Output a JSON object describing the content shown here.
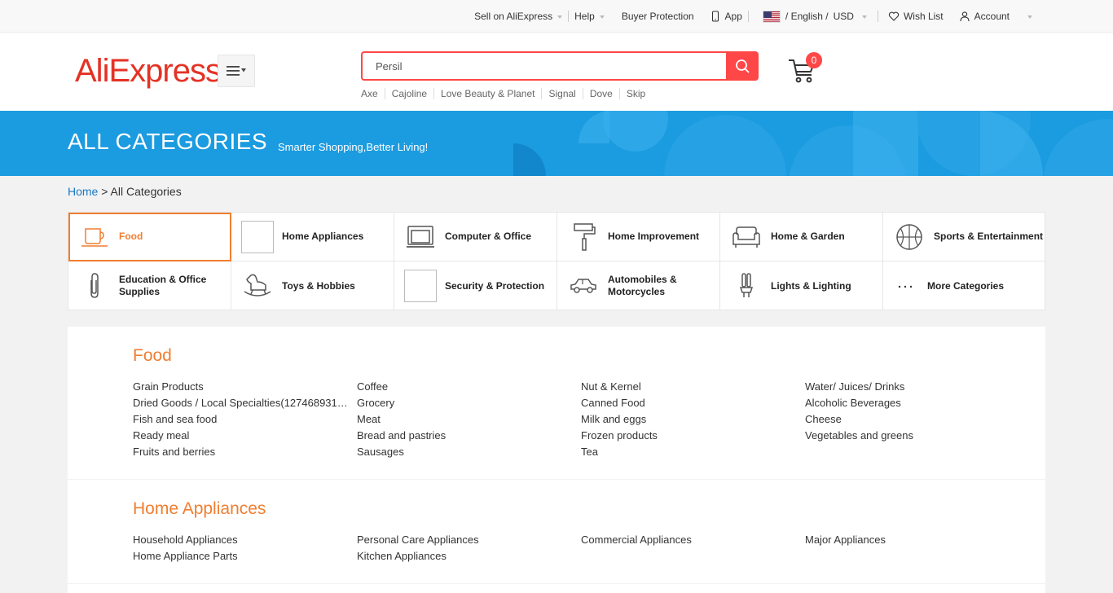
{
  "topbar": {
    "sell": "Sell on AliExpress",
    "help": "Help",
    "buyer_protection": "Buyer Protection",
    "app": "App",
    "language": "/ English /",
    "currency": "USD",
    "wishlist": "Wish List",
    "account": "Account"
  },
  "header": {
    "logo": "AliExpress",
    "search_value": "Persil",
    "hot_words": [
      "Axe",
      "Cajoline",
      "Love Beauty & Planet",
      "Signal",
      "Dove",
      "Skip"
    ],
    "cart_count": "0"
  },
  "banner": {
    "title": "ALL CATEGORIES",
    "subtitle": "Smarter Shopping,Better Living!"
  },
  "breadcrumb": {
    "home": "Home",
    "separator": " > ",
    "current": "All Categories"
  },
  "categories": [
    {
      "label": "Food",
      "icon": "cup-icon"
    },
    {
      "label": "Home Appliances",
      "icon": "broken-image-icon"
    },
    {
      "label": "Computer & Office",
      "icon": "laptop-icon"
    },
    {
      "label": "Home Improvement",
      "icon": "paint-roller-icon"
    },
    {
      "label": "Home & Garden",
      "icon": "sofa-icon"
    },
    {
      "label": "Sports & Entertainment",
      "icon": "basketball-icon"
    },
    {
      "label": "Education & Office Supplies",
      "icon": "paperclip-icon"
    },
    {
      "label": "Toys & Hobbies",
      "icon": "rocking-horse-icon"
    },
    {
      "label": "Security & Protection",
      "icon": "broken-image-icon"
    },
    {
      "label": "Automobiles & Motorcycles",
      "icon": "car-icon"
    },
    {
      "label": "Lights & Lighting",
      "icon": "bulb-icon"
    },
    {
      "label": "More Categories",
      "icon": "ellipsis-icon"
    }
  ],
  "sections": [
    {
      "title": "Food",
      "items": [
        "Grain Products",
        "Coffee",
        "Nut & Kernel",
        "Water/ Juices/ Drinks",
        "Dried Goods / Local Specialties(127468931…",
        "Grocery",
        "Canned Food",
        "Alcoholic Beverages",
        "Fish and sea food",
        "Meat",
        "Milk and eggs",
        "Cheese",
        "Ready meal",
        "Bread and pastries",
        "Frozen products",
        "Vegetables and greens",
        "Fruits and berries",
        "Sausages",
        "Tea"
      ]
    },
    {
      "title": "Home Appliances",
      "items": [
        "Household Appliances",
        "Personal Care Appliances",
        "Commercial Appliances",
        "Major Appliances",
        "Home Appliance Parts",
        "Kitchen Appliances"
      ]
    }
  ],
  "colors": {
    "brand_red": "#e43225",
    "search_red": "#ff4747",
    "banner_blue": "#1b9be0",
    "accent_orange": "#f07e31",
    "link_blue": "#1a79c7"
  }
}
